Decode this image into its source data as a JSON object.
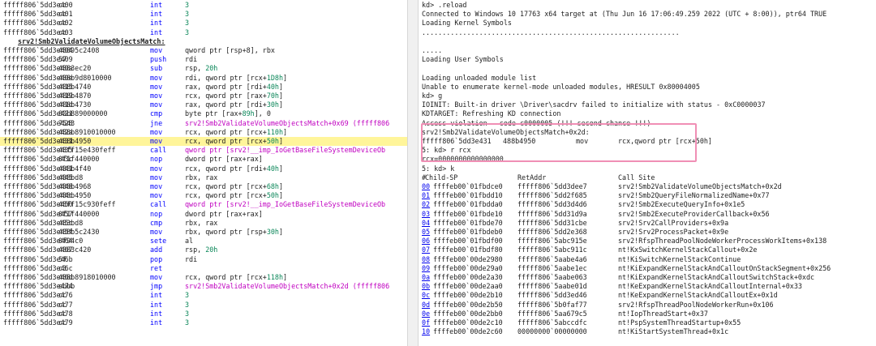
{
  "disassembly": [
    {
      "kind": "ins",
      "addr": "fffff806`5dd3e400",
      "bytes": "cc",
      "mnem": "int",
      "ops": [
        {
          "t": "3",
          "c": "num"
        }
      ]
    },
    {
      "kind": "ins",
      "addr": "fffff806`5dd3e401",
      "bytes": "cc",
      "mnem": "int",
      "ops": [
        {
          "t": "3",
          "c": "num"
        }
      ]
    },
    {
      "kind": "ins",
      "addr": "fffff806`5dd3e402",
      "bytes": "cc",
      "mnem": "int",
      "ops": [
        {
          "t": "3",
          "c": "num"
        }
      ]
    },
    {
      "kind": "ins",
      "addr": "fffff806`5dd3e403",
      "bytes": "cc",
      "mnem": "int",
      "ops": [
        {
          "t": "3",
          "c": "num"
        }
      ]
    },
    {
      "kind": "label",
      "text": "srv2!Smb2ValidateVolumeObjectsMatch:"
    },
    {
      "kind": "ins",
      "addr": "fffff806`5dd3e404",
      "bytes": "48895c2408",
      "mnem": "mov",
      "ops": [
        {
          "t": "qword ptr [rsp+8], rbx"
        }
      ]
    },
    {
      "kind": "ins",
      "addr": "fffff806`5dd3e409",
      "bytes": "57",
      "mnem": "push",
      "ops": [
        {
          "t": "rdi"
        }
      ]
    },
    {
      "kind": "ins",
      "addr": "fffff806`5dd3e40a",
      "bytes": "4883ec20",
      "mnem": "sub",
      "ops": [
        {
          "t": "rsp, "
        },
        {
          "t": "20h",
          "c": "num"
        }
      ]
    },
    {
      "kind": "ins",
      "addr": "fffff806`5dd3e40e",
      "bytes": "488b9d8010000",
      "mnem": "mov",
      "ops": [
        {
          "t": "rdi, qword ptr [rcx+"
        },
        {
          "t": "1D8h",
          "c": "num"
        },
        {
          "t": "]"
        }
      ]
    },
    {
      "kind": "ins",
      "addr": "fffff806`5dd3e415",
      "bytes": "488b4740",
      "mnem": "mov",
      "ops": [
        {
          "t": "rax, qword ptr [rdi+"
        },
        {
          "t": "40h",
          "c": "num"
        },
        {
          "t": "]"
        }
      ]
    },
    {
      "kind": "ins",
      "addr": "fffff806`5dd3e419",
      "bytes": "488b4870",
      "mnem": "mov",
      "ops": [
        {
          "t": "rcx, qword ptr [rax+"
        },
        {
          "t": "70h",
          "c": "num"
        },
        {
          "t": "]"
        }
      ]
    },
    {
      "kind": "ins",
      "addr": "fffff806`5dd3e41d",
      "bytes": "488b4730",
      "mnem": "mov",
      "ops": [
        {
          "t": "rax, qword ptr [rdi+"
        },
        {
          "t": "30h",
          "c": "num"
        },
        {
          "t": "]"
        }
      ]
    },
    {
      "kind": "ins",
      "addr": "fffff806`5dd3e421",
      "bytes": "80b889000000",
      "mnem": "cmp",
      "ops": [
        {
          "t": "byte ptr [rax+"
        },
        {
          "t": "89h",
          "c": "num"
        },
        {
          "t": "], 0"
        }
      ]
    },
    {
      "kind": "ins",
      "addr": "fffff806`5dd3e428",
      "bytes": "7543",
      "mnem": "jne",
      "ops": [
        {
          "t": "srv2!Smb2ValidateVolumeObjectsMatch+0x69 (fffff806",
          "c": "sym"
        }
      ]
    },
    {
      "kind": "ins",
      "addr": "fffff806`5dd3e42a",
      "bytes": "488b8910010000",
      "mnem": "mov",
      "ops": [
        {
          "t": "rcx, qword ptr [rcx+"
        },
        {
          "t": "110h",
          "c": "num"
        },
        {
          "t": "]"
        }
      ]
    },
    {
      "kind": "ins",
      "addr": "fffff806`5dd3e431",
      "bytes": "488b4950",
      "mnem": "mov",
      "ops": [
        {
          "t": "rcx, qword ptr [rcx+"
        },
        {
          "t": "50h",
          "c": "num"
        },
        {
          "t": "]"
        }
      ],
      "current": true
    },
    {
      "kind": "ins",
      "addr": "fffff806`5dd3e435",
      "bytes": "48ff15e430feff",
      "mnem": "call",
      "ops": [
        {
          "t": "qword ptr [srv2!__imp_IoGetBaseFileSystemDeviceOb",
          "c": "sym"
        }
      ]
    },
    {
      "kind": "ins",
      "addr": "fffff806`5dd3e43c",
      "bytes": "0f1f440000",
      "mnem": "nop",
      "ops": [
        {
          "t": "dword ptr [rax+rax]"
        }
      ]
    },
    {
      "kind": "ins",
      "addr": "fffff806`5dd3e441",
      "bytes": "488b4f40",
      "mnem": "mov",
      "ops": [
        {
          "t": "rcx, qword ptr [rdi+"
        },
        {
          "t": "40h",
          "c": "num"
        },
        {
          "t": "]"
        }
      ]
    },
    {
      "kind": "ins",
      "addr": "fffff806`5dd3e445",
      "bytes": "488bd8",
      "mnem": "mov",
      "ops": [
        {
          "t": "rbx, rax"
        }
      ]
    },
    {
      "kind": "ins",
      "addr": "fffff806`5dd3e448",
      "bytes": "488b4968",
      "mnem": "mov",
      "ops": [
        {
          "t": "rcx, qword ptr [rcx+"
        },
        {
          "t": "68h",
          "c": "num"
        },
        {
          "t": "]"
        }
      ]
    },
    {
      "kind": "ins",
      "addr": "fffff806`5dd3e44c",
      "bytes": "488b4950",
      "mnem": "mov",
      "ops": [
        {
          "t": "rcx, qword ptr [rcx+"
        },
        {
          "t": "50h",
          "c": "num"
        },
        {
          "t": "]"
        }
      ]
    },
    {
      "kind": "ins",
      "addr": "fffff806`5dd3e450",
      "bytes": "48ff15c930feff",
      "mnem": "call",
      "ops": [
        {
          "t": "qword ptr [srv2!__imp_IoGetBaseFileSystemDeviceOb",
          "c": "sym"
        }
      ]
    },
    {
      "kind": "ins",
      "addr": "fffff806`5dd3e457",
      "bytes": "0f1f440000",
      "mnem": "nop",
      "ops": [
        {
          "t": "dword ptr [rax+rax]"
        }
      ]
    },
    {
      "kind": "ins",
      "addr": "fffff806`5dd3e45c",
      "bytes": "483bd8",
      "mnem": "cmp",
      "ops": [
        {
          "t": "rbx, rax"
        }
      ]
    },
    {
      "kind": "ins",
      "addr": "fffff806`5dd3e45f",
      "bytes": "488b5c2430",
      "mnem": "mov",
      "ops": [
        {
          "t": "rbx, qword ptr [rsp+"
        },
        {
          "t": "30h",
          "c": "num"
        },
        {
          "t": "]"
        }
      ]
    },
    {
      "kind": "ins",
      "addr": "fffff806`5dd3e464",
      "bytes": "0f94c0",
      "mnem": "sete",
      "ops": [
        {
          "t": "al"
        }
      ]
    },
    {
      "kind": "ins",
      "addr": "fffff806`5dd3e467",
      "bytes": "4883c420",
      "mnem": "add",
      "ops": [
        {
          "t": "rsp, "
        },
        {
          "t": "20h",
          "c": "num"
        }
      ]
    },
    {
      "kind": "ins",
      "addr": "fffff806`5dd3e46b",
      "bytes": "5f",
      "mnem": "pop",
      "ops": [
        {
          "t": "rdi"
        }
      ]
    },
    {
      "kind": "ins",
      "addr": "fffff806`5dd3e46c",
      "bytes": "c3",
      "mnem": "ret",
      "ops": []
    },
    {
      "kind": "ins",
      "addr": "fffff806`5dd3e46d",
      "bytes": "488b8918010000",
      "mnem": "mov",
      "ops": [
        {
          "t": "rcx, qword ptr [rcx+"
        },
        {
          "t": "118h",
          "c": "num"
        },
        {
          "t": "]"
        }
      ]
    },
    {
      "kind": "ins",
      "addr": "fffff806`5dd3e474",
      "bytes": "ebbb",
      "mnem": "jmp",
      "ops": [
        {
          "t": "srv2!Smb2ValidateVolumeObjectsMatch+0x2d (fffff806",
          "c": "sym"
        }
      ]
    },
    {
      "kind": "ins",
      "addr": "fffff806`5dd3e476",
      "bytes": "cc",
      "mnem": "int",
      "ops": [
        {
          "t": "3",
          "c": "num"
        }
      ]
    },
    {
      "kind": "ins",
      "addr": "fffff806`5dd3e477",
      "bytes": "cc",
      "mnem": "int",
      "ops": [
        {
          "t": "3",
          "c": "num"
        }
      ]
    },
    {
      "kind": "ins",
      "addr": "fffff806`5dd3e478",
      "bytes": "cc",
      "mnem": "int",
      "ops": [
        {
          "t": "3",
          "c": "num"
        }
      ]
    },
    {
      "kind": "ins",
      "addr": "fffff806`5dd3e479",
      "bytes": "cc",
      "mnem": "int",
      "ops": [
        {
          "t": "3",
          "c": "num"
        }
      ]
    }
  ],
  "command": [
    {
      "kind": "text",
      "text": "kd> .reload"
    },
    {
      "kind": "text",
      "text": "Connected to Windows 10 17763 x64 target at (Thu Jun 16 17:06:49.259 2022 (UTC + 8:00)), ptr64 TRUE"
    },
    {
      "kind": "text",
      "text": "Loading Kernel Symbols"
    },
    {
      "kind": "text",
      "text": "..............................................................."
    },
    {
      "kind": "text",
      "text": ""
    },
    {
      "kind": "text",
      "text": "....."
    },
    {
      "kind": "text",
      "text": "Loading User Symbols"
    },
    {
      "kind": "text",
      "text": ""
    },
    {
      "kind": "text",
      "text": "Loading unloaded module list"
    },
    {
      "kind": "text",
      "text": "Unable to enumerate kernel-mode unloaded modules, HRESULT 0x80004005"
    },
    {
      "kind": "text",
      "text": "kd> g"
    },
    {
      "kind": "text",
      "text": "IOINIT: Built-in driver \\Driver\\sacdrv failed to initialize with status - 0xC0000037"
    },
    {
      "kind": "text",
      "text": "KDTARGET: Refreshing KD connection"
    },
    {
      "kind": "text",
      "text": "Access violation - code c0000005 (!!! second chance !!!)"
    },
    {
      "kind": "text",
      "text": "srv2!Smb2ValidateVolumeObjectsMatch+0x2d:"
    },
    {
      "kind": "dis",
      "addr": "fffff806`5dd3e431",
      "bytes": "488b4950",
      "mnem": "mov",
      "ops": "rcx,qword ptr [rcx+50h]"
    },
    {
      "kind": "text",
      "text": "5: kd> r rcx"
    },
    {
      "kind": "text",
      "text": "rcx=0000000000000000"
    },
    {
      "kind": "text",
      "text": "5: kd> k"
    },
    {
      "kind": "head",
      "num": "#",
      "sp": "Child-SP",
      "ret": "RetAddr",
      "site": "Call Site"
    },
    {
      "kind": "frame",
      "num": "00",
      "sp": "ffffeb00`01fbdce0",
      "ret": "fffff806`5dd3dee7",
      "site": "srv2!Smb2ValidateVolumeObjectsMatch+0x2d"
    },
    {
      "kind": "frame",
      "num": "01",
      "sp": "ffffeb00`01fbdd10",
      "ret": "fffff806`5dd2f685",
      "site": "srv2!Smb2QueryFileNormalizedName+0x77"
    },
    {
      "kind": "frame",
      "num": "02",
      "sp": "ffffeb00`01fbdda0",
      "ret": "fffff806`5dd3d4d6",
      "site": "srv2!Smb2ExecuteQueryInfo+0x1e5"
    },
    {
      "kind": "frame",
      "num": "03",
      "sp": "ffffeb00`01fbde10",
      "ret": "fffff806`5dd31d9a",
      "site": "srv2!Smb2ExecuteProviderCallback+0x56"
    },
    {
      "kind": "frame",
      "num": "04",
      "sp": "ffffeb00`01fbde70",
      "ret": "fffff806`5dd31cbe",
      "site": "srv2!Srv2CallProviders+0x9a"
    },
    {
      "kind": "frame",
      "num": "05",
      "sp": "ffffeb00`01fbdeb0",
      "ret": "fffff806`5dd2e368",
      "site": "srv2!Srv2ProcessPacket+0x9e"
    },
    {
      "kind": "frame",
      "num": "06",
      "sp": "ffffeb00`01fbdf00",
      "ret": "fffff806`5abc915e",
      "site": "srv2!RfspThreadPoolNodeWorkerProcessWorkItems+0x138"
    },
    {
      "kind": "frame",
      "num": "07",
      "sp": "ffffeb00`01fbdf80",
      "ret": "fffff806`5abc911c",
      "site": "nt!KxSwitchKernelStackCallout+0x2e"
    },
    {
      "kind": "frame",
      "num": "08",
      "sp": "ffffeb00`00de2980",
      "ret": "fffff806`5aabe4a6",
      "site": "nt!KiSwitchKernelStackContinue"
    },
    {
      "kind": "frame",
      "num": "09",
      "sp": "ffffeb00`00de29a0",
      "ret": "fffff806`5aabe1ec",
      "site": "nt!KiExpandKernelStackAndCalloutOnStackSegment+0x256"
    },
    {
      "kind": "frame",
      "num": "0a",
      "sp": "ffffeb00`00de2a30",
      "ret": "fffff806`5aabe063",
      "site": "nt!KiExpandKernelStackAndCalloutSwitchStack+0xdc"
    },
    {
      "kind": "frame",
      "num": "0b",
      "sp": "ffffeb00`00de2aa0",
      "ret": "fffff806`5aabe01d",
      "site": "nt!KeExpandKernelStackAndCalloutInternal+0x33"
    },
    {
      "kind": "frame",
      "num": "0c",
      "sp": "ffffeb00`00de2b10",
      "ret": "fffff806`5dd3ed46",
      "site": "nt!KeExpandKernelStackAndCalloutEx+0x1d"
    },
    {
      "kind": "frame",
      "num": "0d",
      "sp": "ffffeb00`00de2b50",
      "ret": "fffff806`5b0faf77",
      "site": "srv2!RfspThreadPoolNodeWorkerRun+0x106"
    },
    {
      "kind": "frame",
      "num": "0e",
      "sp": "ffffeb00`00de2bb0",
      "ret": "fffff806`5aa679c5",
      "site": "nt!IopThreadStart+0x37"
    },
    {
      "kind": "frame",
      "num": "0f",
      "sp": "ffffeb00`00de2c10",
      "ret": "fffff806`5abccdfc",
      "site": "nt!PspSystemThreadStartup+0x55"
    },
    {
      "kind": "frame",
      "num": "10",
      "sp": "ffffeb00`00de2c60",
      "ret": "00000000`00000000",
      "site": "nt!KiStartSystemThread+0x1c"
    }
  ],
  "colors": {
    "mnemonic": "#0000ff",
    "number": "#098658",
    "symbol": "#c000c0",
    "current_line": "#fff59a",
    "highlight_box": "#f08fb5",
    "link": "#0000ee"
  }
}
